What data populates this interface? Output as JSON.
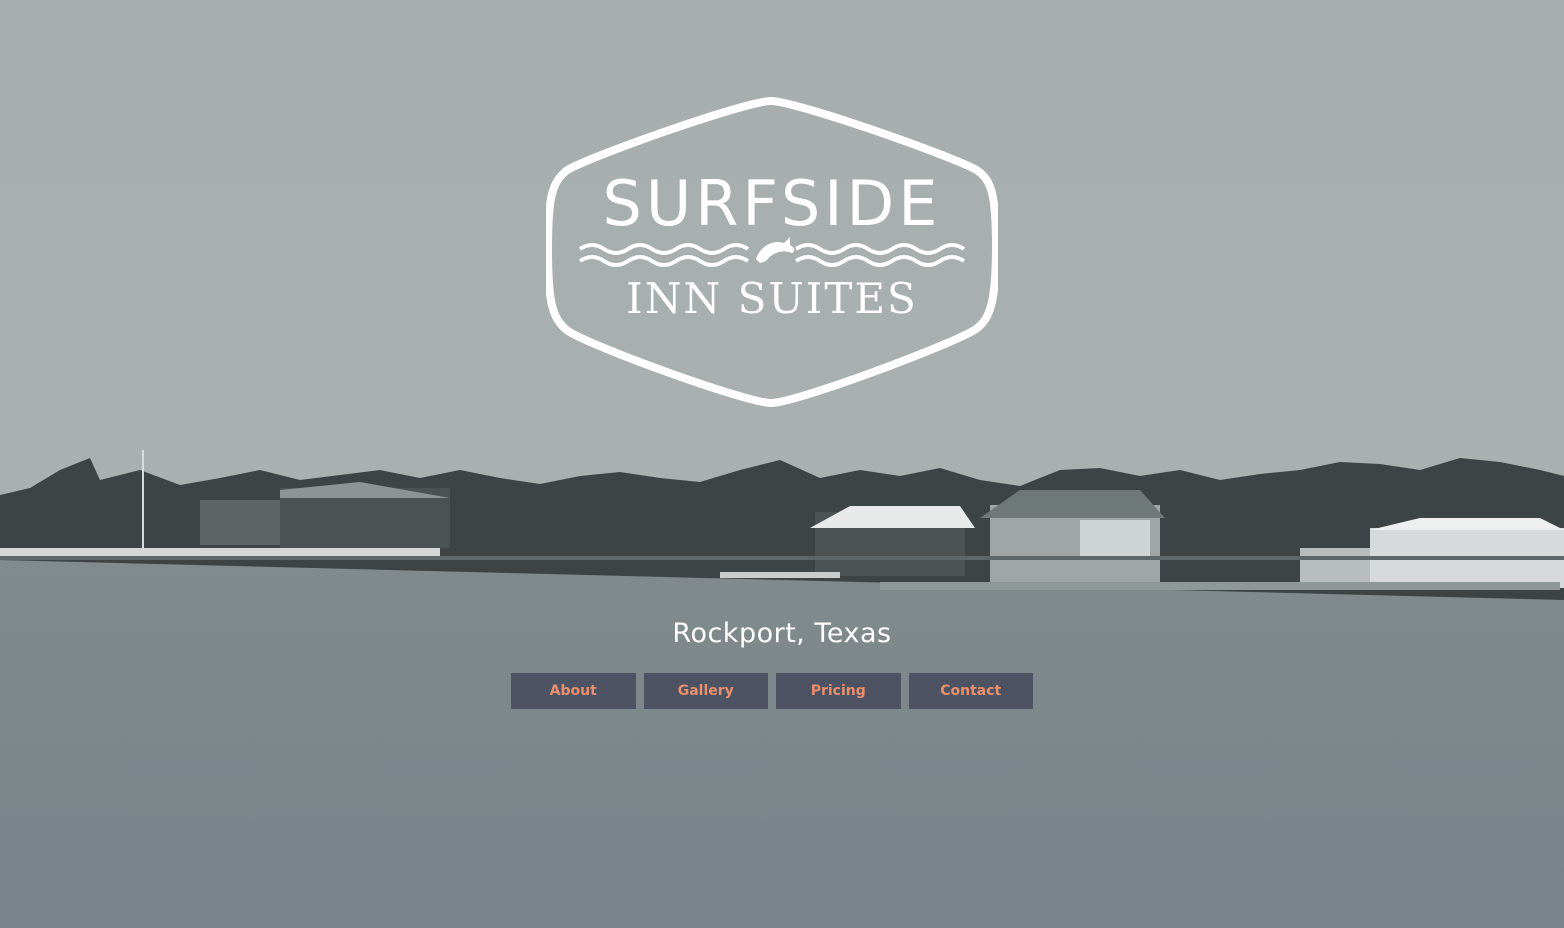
{
  "logo": {
    "line1": "SURFSIDE",
    "line2": "INN SUITES",
    "icon": "dolphin-icon"
  },
  "location": "Rockport, Texas",
  "nav": [
    {
      "label": "About"
    },
    {
      "label": "Gallery"
    },
    {
      "label": "Pricing"
    },
    {
      "label": "Contact"
    }
  ],
  "colors": {
    "nav_bg": "#4e5363",
    "nav_text": "#e88f6d",
    "sky": "#a4adae",
    "water": "#7c878a"
  }
}
